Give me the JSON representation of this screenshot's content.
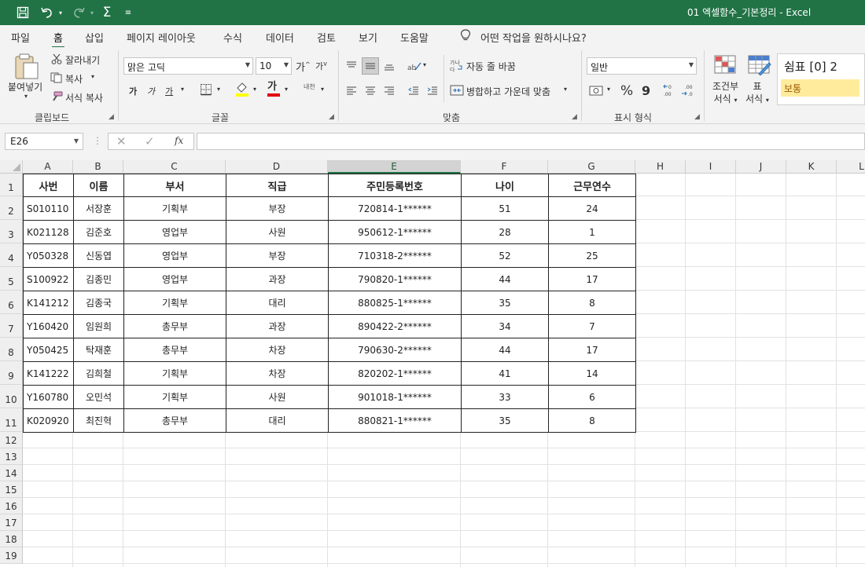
{
  "title_bar": {
    "doc_title": "01 엑셀함수_기본정리  -  Excel",
    "qa_icons": [
      "save-icon",
      "undo-icon",
      "redo-icon",
      "autosum-icon",
      "customize-icon"
    ]
  },
  "menu": {
    "tabs": [
      "파일",
      "홈",
      "삽입",
      "페이지 레이아웃",
      "수식",
      "데이터",
      "검토",
      "보기",
      "도움말"
    ],
    "active_tab": "홈",
    "tell_me": "어떤 작업을 원하시나요?"
  },
  "ribbon": {
    "clipboard": {
      "paste": "붙여넣기",
      "cut": "잘라내기",
      "copy": "복사",
      "format_painter": "서식 복사",
      "label": "클립보드"
    },
    "font": {
      "font_name": "맑은 고딕",
      "font_size": "10",
      "grow": "가",
      "shrink": "가",
      "bold": "가",
      "italic": "가",
      "underline": "가",
      "font_color": "가",
      "phonetic": "내천",
      "label": "글꼴"
    },
    "alignment": {
      "wrap_text": "자동 줄 바꿈",
      "merge_center": "병합하고 가운데 맞춤",
      "label": "맞춤"
    },
    "number": {
      "format": "일반",
      "percent": "%",
      "comma": "9",
      "label": "표시 형식"
    },
    "styles": {
      "conditional": [
        "조건부",
        "서식"
      ],
      "table": [
        "표",
        "서식"
      ],
      "style1": "쉼표 [0] 2",
      "style2": "보통"
    }
  },
  "formula_bar": {
    "name_box": "E26",
    "formula": "",
    "fx": "fx"
  },
  "sheet": {
    "columns": [
      "A",
      "B",
      "C",
      "D",
      "E",
      "F",
      "G",
      "H",
      "I",
      "J",
      "K",
      "L"
    ],
    "selected_column": "E",
    "row_numbers": [
      "1",
      "2",
      "3",
      "4",
      "5",
      "6",
      "7",
      "8",
      "9",
      "10",
      "11",
      "12",
      "13",
      "14",
      "15",
      "16",
      "17",
      "18",
      "19"
    ],
    "headers": [
      "사번",
      "이름",
      "부서",
      "직급",
      "주민등록번호",
      "나이",
      "근무연수"
    ],
    "rows": [
      [
        "S010110",
        "서장훈",
        "기획부",
        "부장",
        "720814-1******",
        "51",
        "24"
      ],
      [
        "K021128",
        "김준호",
        "영업부",
        "사원",
        "950612-1******",
        "28",
        "1"
      ],
      [
        "Y050328",
        "신동엽",
        "영업부",
        "부장",
        "710318-2******",
        "52",
        "25"
      ],
      [
        "S100922",
        "김종민",
        "영업부",
        "과장",
        "790820-1******",
        "44",
        "17"
      ],
      [
        "K141212",
        "김종국",
        "기획부",
        "대리",
        "880825-1******",
        "35",
        "8"
      ],
      [
        "Y160420",
        "임원희",
        "총무부",
        "과장",
        "890422-2******",
        "34",
        "7"
      ],
      [
        "Y050425",
        "탁재훈",
        "총무부",
        "차장",
        "790630-2******",
        "44",
        "17"
      ],
      [
        "K141222",
        "김희철",
        "기획부",
        "차장",
        "820202-1******",
        "41",
        "14"
      ],
      [
        "Y160780",
        "오민석",
        "기획부",
        "사원",
        "901018-1******",
        "33",
        "6"
      ],
      [
        "K020920",
        "최진혁",
        "총무부",
        "대리",
        "880821-1******",
        "35",
        "8"
      ]
    ]
  },
  "colors": {
    "excel_green": "#217346",
    "ribbon_bg": "#f3f3f3",
    "neutral_style_bg": "#ffeb9c"
  }
}
